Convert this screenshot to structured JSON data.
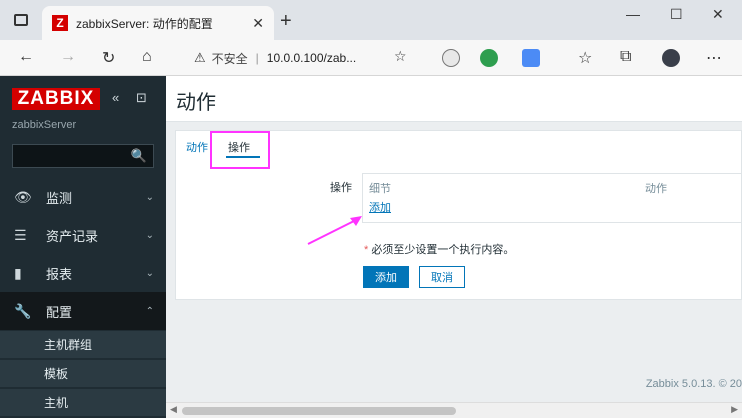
{
  "browser": {
    "tab_title": "zabbixServer: 动作的配置",
    "tab_favicon": "Z",
    "address_warning": "不安全",
    "address_url": "10.0.0.100/zab...",
    "accent": "#d40000"
  },
  "sidebar": {
    "logo": "ZABBIX",
    "server_name": "zabbixServer",
    "menu": [
      {
        "label": "监测",
        "icon": "eye-icon",
        "glyph": "👁"
      },
      {
        "label": "资产记录",
        "icon": "list-icon",
        "glyph": "☰"
      },
      {
        "label": "报表",
        "icon": "bar-chart-icon",
        "glyph": "▮"
      },
      {
        "label": "配置",
        "icon": "wrench-icon",
        "glyph": "🔧"
      }
    ],
    "submenu": [
      "主机群组",
      "模板",
      "主机"
    ]
  },
  "main": {
    "title": "动作",
    "tabs": [
      "动作",
      "操作"
    ],
    "field_label": "操作",
    "columns": [
      "细节",
      "动作"
    ],
    "add_link": "添加",
    "note_star": "*",
    "note": "必须至少设置一个执行内容。",
    "buttons": {
      "add": "添加",
      "cancel": "取消"
    },
    "footer": "Zabbix 5.0.13. © 20"
  }
}
